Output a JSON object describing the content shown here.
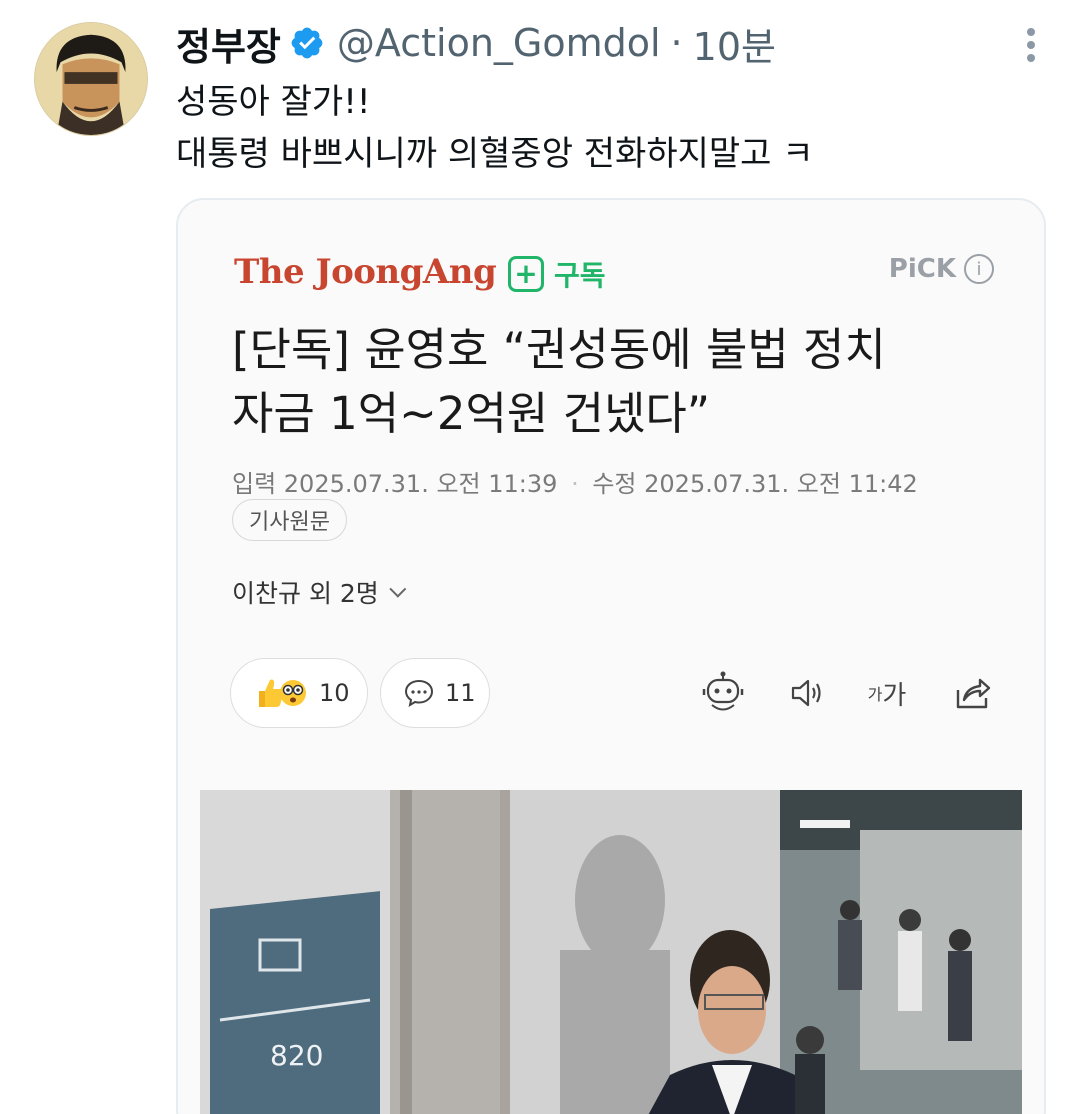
{
  "tweet": {
    "display_name": "정부장",
    "handle": "@Action_Gomdol",
    "separator": "·",
    "time": "10분",
    "text_lines": [
      "성동아 잘가!!",
      "대통령 바쁘시니까 의혈중앙 전화하지말고 ㅋ"
    ]
  },
  "card": {
    "publisher": "The JoongAng",
    "subscribe_label": "구독",
    "pick_label": "PiCK",
    "headline_lines": [
      "[단독] 윤영호 “권성동에 불법 정치",
      "자금 1억~2억원 건넸다”"
    ],
    "published": "입력 2025.07.31. 오전 11:39",
    "date_separator": "·",
    "modified": "수정 2025.07.31. 오전 11:42",
    "original_article_label": "기사원문",
    "authors": "이찬규 외 2명",
    "reaction_count": "10",
    "comment_count": "11",
    "text_size_label_small": "가",
    "text_size_label_large": "가"
  },
  "icons": {
    "verified": "verified-badge-icon",
    "more": "more-dots-icon",
    "robot": "summary-bot-icon",
    "speaker": "text-to-speech-icon",
    "share": "share-icon"
  },
  "colors": {
    "publisher": "#c8452f",
    "subscribe": "#21b56a",
    "verified": "#1d9bf0",
    "meta_text": "#536471"
  }
}
